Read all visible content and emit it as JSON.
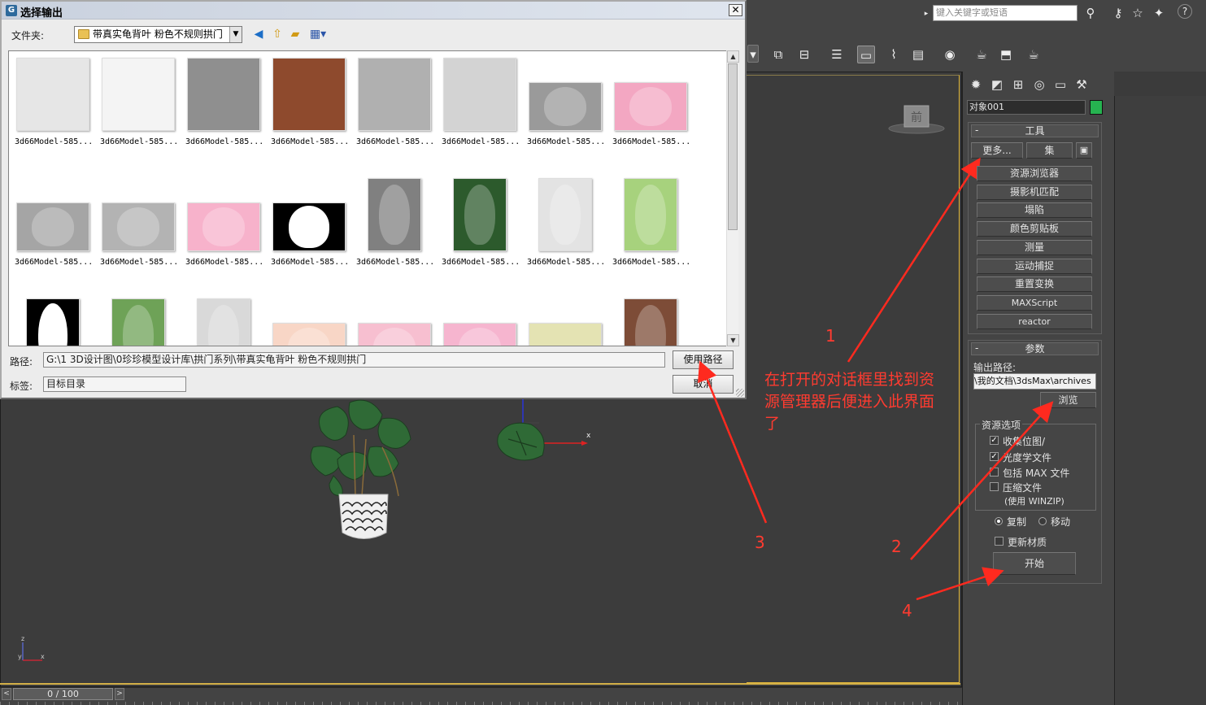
{
  "app": {
    "search_placeholder": "键入关键字或短语",
    "viewport_label": "前"
  },
  "dialog": {
    "title": "选择输出",
    "close_glyph": "✕",
    "folder_label": "文件夹:",
    "folder_value": "带真实龟背叶 粉色不规则拱门",
    "thumbnails": [
      {
        "caption": "3d66Model-585...",
        "color": "#e6e6e6",
        "kind": "tex"
      },
      {
        "caption": "3d66Model-585...",
        "color": "#f4f4f4",
        "kind": "tex"
      },
      {
        "caption": "3d66Model-585...",
        "color": "#8f8f8f",
        "kind": "tex"
      },
      {
        "caption": "3d66Model-585...",
        "color": "#8e4a2d",
        "kind": "tex"
      },
      {
        "caption": "3d66Model-585...",
        "color": "#b0b0b0",
        "kind": "tex"
      },
      {
        "caption": "3d66Model-585...",
        "color": "#d3d3d3",
        "kind": "tex"
      },
      {
        "caption": "3d66Model-585...",
        "color": "#9a9a9a",
        "kind": "petal-wide"
      },
      {
        "caption": "3d66Model-585...",
        "color": "#f3a7c2",
        "kind": "petal-wide"
      },
      {
        "caption": "3d66Model-585...",
        "color": "#a5a5a5",
        "kind": "petal-wide"
      },
      {
        "caption": "3d66Model-585...",
        "color": "#b3b3b3",
        "kind": "petal-wide"
      },
      {
        "caption": "3d66Model-585...",
        "color": "#f7b2cb",
        "kind": "petal-wide"
      },
      {
        "caption": "3d66Model-585...",
        "color": "#000000",
        "kind": "mask-wide"
      },
      {
        "caption": "3d66Model-585...",
        "color": "#808080",
        "kind": "leaf"
      },
      {
        "caption": "3d66Model-585...",
        "color": "#2c5a2c",
        "kind": "leaf"
      },
      {
        "caption": "3d66Model-585...",
        "color": "#e3e3e3",
        "kind": "leaf"
      },
      {
        "caption": "3d66Model-585...",
        "color": "#a7d27d",
        "kind": "leaf"
      },
      {
        "caption": "",
        "color": "#000000",
        "kind": "mask-leaf"
      },
      {
        "caption": "",
        "color": "#6ea257",
        "kind": "leaf"
      },
      {
        "caption": "",
        "color": "#d9d9d9",
        "kind": "leaf"
      },
      {
        "caption": "",
        "color": "#f8d6c6",
        "kind": "petal-cut"
      },
      {
        "caption": "",
        "color": "#f7bfd0",
        "kind": "petal-cut"
      },
      {
        "caption": "",
        "color": "#f6b5cf",
        "kind": "petal-cut"
      },
      {
        "caption": "",
        "color": "#e4e3b3",
        "kind": "tex-cut"
      },
      {
        "caption": "",
        "color": "#7d4c37",
        "kind": "leaf-cut"
      }
    ],
    "path_label": "路径:",
    "path_value": "G:\\1 3D设计图\\0珍珍模型设计库\\拱门系列\\带真实龟背叶 粉色不规则拱门",
    "tag_label": "标签:",
    "tag_value": "目标目录",
    "use_path_button": "使用路径",
    "cancel_button": "取消"
  },
  "command_panel": {
    "object_name": "对象001",
    "object_color": "#26b350",
    "tools_rollout": {
      "title": "工具",
      "more_button": "更多...",
      "sets_button": "集",
      "items": [
        "资源浏览器",
        "摄影机匹配",
        "塌陷",
        "颜色剪贴板",
        "测量",
        "运动捕捉",
        "重置变换",
        "MAXScript",
        "reactor"
      ]
    },
    "params_rollout": {
      "title": "参数",
      "output_path_label": "输出路径:",
      "output_path_value": "\\我的文档\\3dsMax\\archives",
      "browse_button": "浏览",
      "resource_options_title": "资源选项",
      "collect_bitmaps_label": "收集位图/",
      "photometric_label": "光度学文件",
      "include_max_label": "包括 MAX 文件",
      "compress_label": "压缩文件",
      "compress_sub_label": "(使用 WINZIP)",
      "copy_label": "复制",
      "move_label": "移动",
      "update_material_label": "更新材质",
      "start_button": "开始",
      "collect_bitmaps_checked": true,
      "photometric_checked": true,
      "include_max_checked": false,
      "compress_checked": false,
      "update_material_checked": false,
      "copy_selected": true
    }
  },
  "timeline": {
    "frame_display": "0 / 100",
    "prev_glyph": "<",
    "next_glyph": ">"
  },
  "annotations": {
    "n1": "1",
    "n2": "2",
    "n3": "3",
    "n4": "4",
    "note": "在打开的对话框里找到资源管理器后便进入此界面了"
  },
  "axis": {
    "x": "x",
    "z": "z",
    "y": "y"
  }
}
